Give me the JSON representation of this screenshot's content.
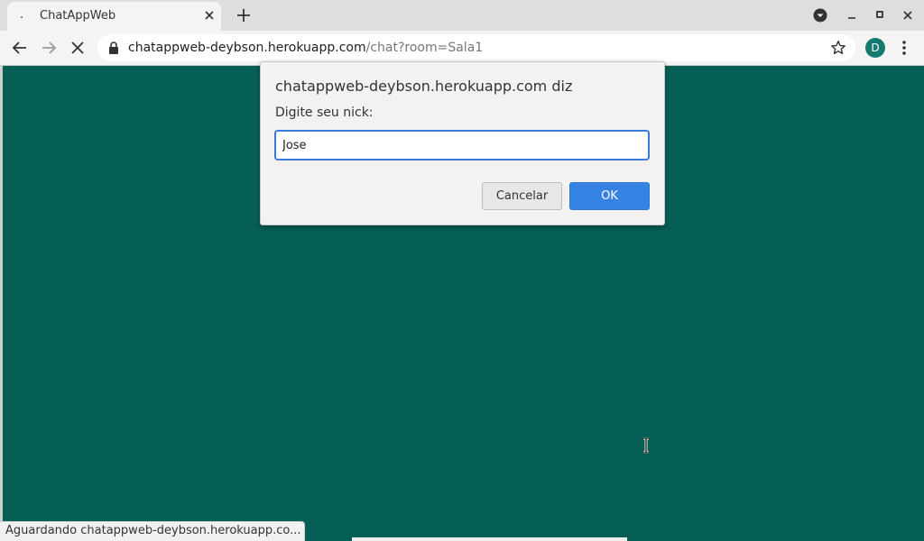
{
  "browser": {
    "tab": {
      "loading_indicator": ".",
      "title": "ChatAppWeb"
    },
    "address": {
      "host": "chatappweb-deybson.herokuapp.com",
      "path": "/chat?room=Sala1"
    },
    "profile_initial": "D",
    "status_text": "Aguardando chatappweb-deybson.herokuapp.co..."
  },
  "dialog": {
    "origin": "chatappweb-deybson.herokuapp.com diz",
    "label": "Digite seu nick:",
    "input_value": "Jose",
    "cancel_label": "Cancelar",
    "ok_label": "OK"
  },
  "colors": {
    "page_background": "#065f55",
    "accent": "#3584e4",
    "avatar": "#137a6e"
  },
  "icons": [
    "close-icon",
    "plus-icon",
    "back-arrow-icon",
    "forward-arrow-icon",
    "stop-icon",
    "lock-icon",
    "star-icon",
    "kebab-menu-icon",
    "text-cursor-icon"
  ]
}
